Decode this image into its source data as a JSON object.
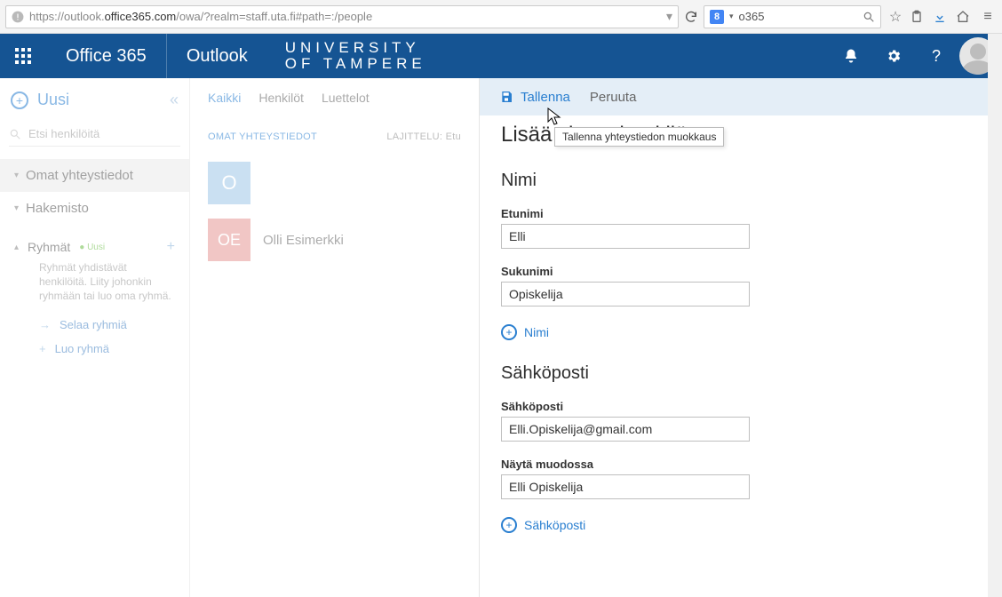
{
  "browser": {
    "url_prefix": "https://outlook.",
    "url_bold": "office365.com",
    "url_suffix": "/owa/?realm=staff.uta.fi#path=:/people",
    "search_provider_letter": "8",
    "search_text": "o365"
  },
  "suite": {
    "brand": "Office 365",
    "app": "Outlook",
    "university_line1": "UNIVERSITY",
    "university_line2": "OF TAMPERE"
  },
  "leftnav": {
    "new_label": "Uusi",
    "search_placeholder": "Etsi henkilöitä",
    "item_mycontacts": "Omat yhteystiedot",
    "item_directory": "Hakemisto",
    "groups_label": "Ryhmät",
    "groups_new_badge": "● Uusi",
    "groups_desc": "Ryhmät yhdistävät henkilöitä. Liity johonkin ryhmään tai luo oma ryhmä.",
    "browse_groups": "Selaa ryhmiä",
    "create_group": "Luo ryhmä"
  },
  "mid": {
    "tab_all": "Kaikki",
    "tab_people": "Henkilöt",
    "tab_lists": "Luettelot",
    "section_my": "OMAT YHTEYSTIEDOT",
    "sort_label": "LAJITTELU: Etu",
    "letter_header": "O",
    "contact_initials": "OE",
    "contact_name": "Olli Esimerkki"
  },
  "panel": {
    "save": "Tallenna",
    "cancel": "Peruuta",
    "tooltip": "Tallenna yhteystiedon muokkaus",
    "title": "Lisää yhteyshenkilö",
    "section_name": "Nimi",
    "label_firstname": "Etunimi",
    "value_firstname": "Elli",
    "label_lastname": "Sukunimi",
    "value_lastname": "Opiskelija",
    "add_name": "Nimi",
    "section_email": "Sähköposti",
    "label_email": "Sähköposti",
    "value_email": "Elli.Opiskelija@gmail.com",
    "label_displayas": "Näytä muodossa",
    "value_displayas": "Elli Opiskelija",
    "add_email": "Sähköposti"
  }
}
